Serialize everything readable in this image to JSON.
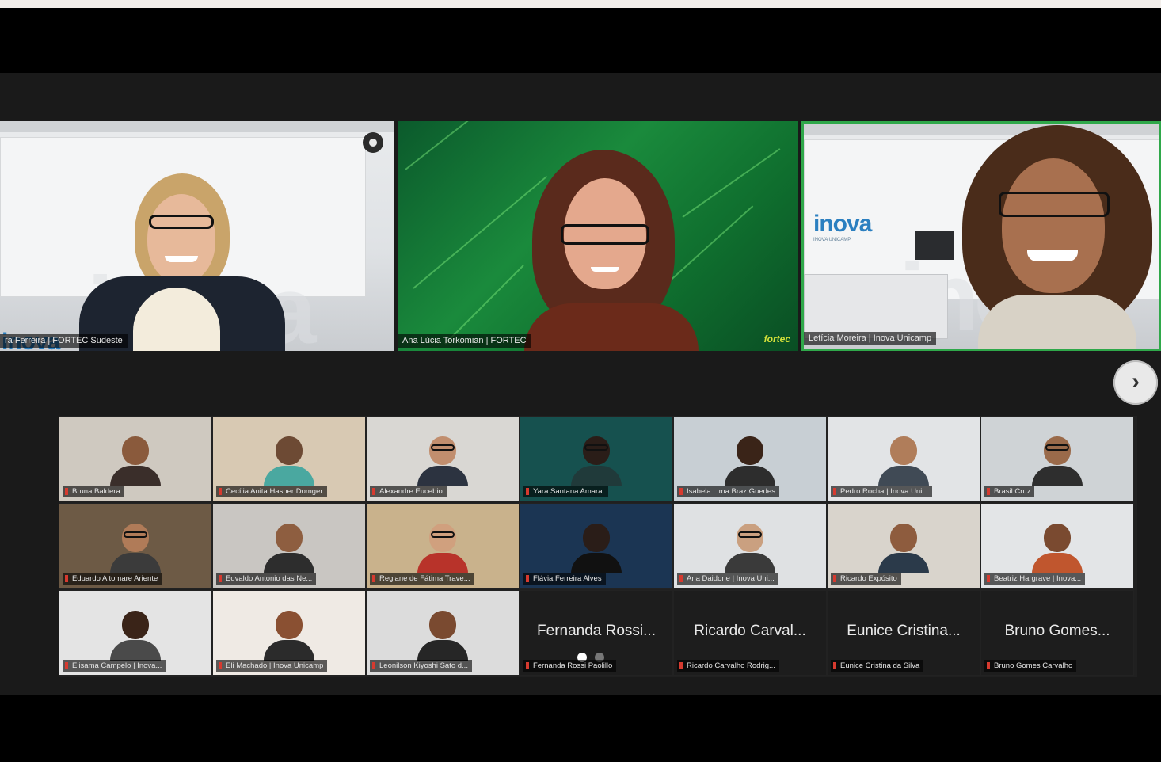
{
  "speakers": [
    {
      "name": "ra Ferreira | FORTEC Sudeste",
      "logo": "inova",
      "active": false
    },
    {
      "name": "Ana Lúcia Torkomian | FORTEC",
      "logo": "fortec",
      "active": false
    },
    {
      "name": "Letícia Moreira | Inova Unicamp",
      "logo": "inova",
      "active": true
    }
  ],
  "next_button": {
    "icon": "chevron-right-icon",
    "glyph": "›"
  },
  "gallery": [
    {
      "name": "Bruna Baldera",
      "bg": "#cfc9c0"
    },
    {
      "name": "Cecília Anita Hasner Domger",
      "bg": "#d8c9b3"
    },
    {
      "name": "Alexandre Eucebio",
      "bg": "#d9d7d3"
    },
    {
      "name": "Yara Santana Amaral",
      "bg": "#16514f"
    },
    {
      "name": "Isabela Lima Braz Guedes",
      "bg": "#c8cfd4"
    },
    {
      "name": "Pedro Rocha | Inova Uni...",
      "bg": "#e2e4e6"
    },
    {
      "name": "Brasil Cruz",
      "bg": "#cfd3d6"
    },
    {
      "name": "Eduardo Altomare Ariente",
      "bg": "#6d5a45"
    },
    {
      "name": "Edvaldo Antonio das Ne...",
      "bg": "#c9c6c2"
    },
    {
      "name": "Regiane de Fátima Trave...",
      "bg": "#c9b28c"
    },
    {
      "name": "Flávia Ferreira Alves",
      "bg": "#1b3553"
    },
    {
      "name": "Ana Daidone | Inova Uni...",
      "bg": "#dfe1e3"
    },
    {
      "name": "Ricardo Expósito",
      "bg": "#d9d4cc"
    },
    {
      "name": "Beatriz Hargrave | Inova...",
      "bg": "#e3e5e7"
    },
    {
      "name": "Elisama Campelo | Inova...",
      "bg": "#e4e4e4"
    },
    {
      "name": "Eli Machado | Inova Unicamp",
      "bg": "#efeae4"
    },
    {
      "name": "Leonilson Kiyoshi Sato d...",
      "bg": "#dcdcdc"
    },
    {
      "name": "Fernanda Rossi Paolillo",
      "big": "Fernanda Rossi...",
      "name_only": true
    },
    {
      "name": "Ricardo Carvalho Rodrig...",
      "big": "Ricardo Carval...",
      "name_only": true
    },
    {
      "name": "Eunice Cristina da Silva",
      "big": "Eunice Cristina...",
      "name_only": true
    },
    {
      "name": "Bruno Gomes Carvalho",
      "big": "Bruno Gomes...",
      "name_only": true
    }
  ]
}
